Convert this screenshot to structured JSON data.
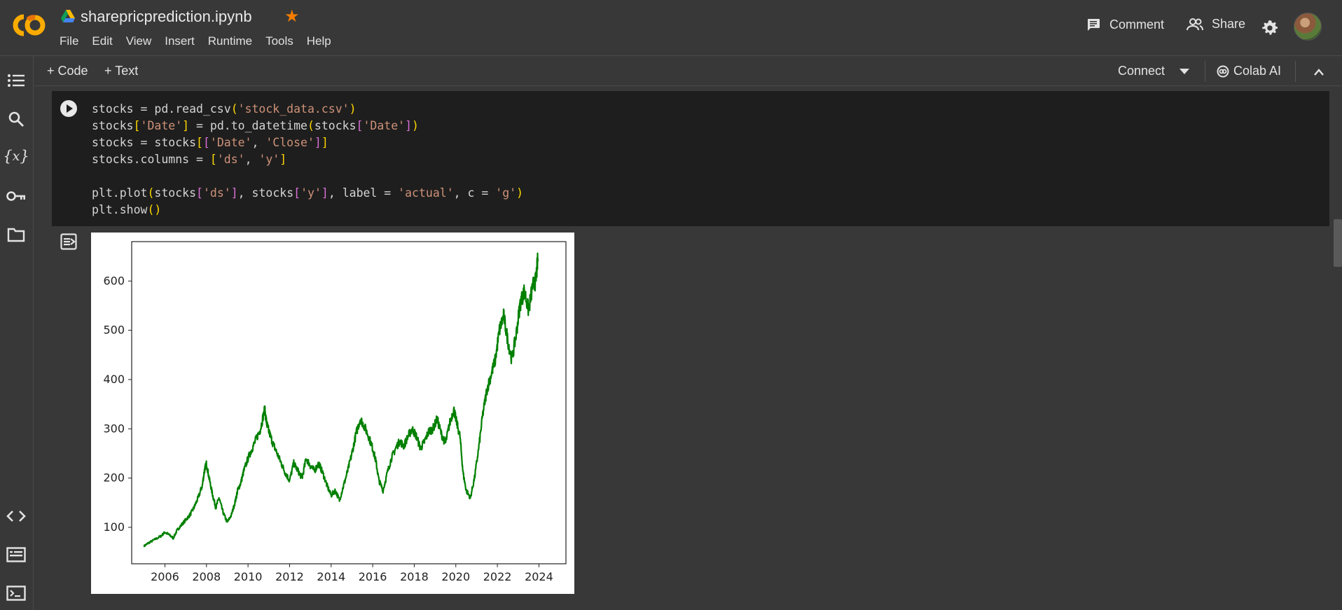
{
  "header": {
    "title": "sharepricprediction.ipynb",
    "menu": [
      "File",
      "Edit",
      "View",
      "Insert",
      "Runtime",
      "Tools",
      "Help"
    ],
    "comment_label": "Comment",
    "share_label": "Share"
  },
  "toolbar": {
    "add_code": "+ Code",
    "add_text": "+ Text",
    "connect": "Connect",
    "colab_ai": "Colab AI"
  },
  "cell": {
    "code_lines": [
      "stocks = pd.read_csv('stock_data.csv')",
      "stocks['Date'] = pd.to_datetime(stocks['Date'])",
      "stocks = stocks[['Date', 'Close']]",
      "stocks.columns = ['ds', 'y']",
      "",
      "plt.plot(stocks['ds'], stocks['y'], label = 'actual', c = 'g')",
      "plt.show()"
    ]
  },
  "colors": {
    "line": "#008000",
    "star": "#f57c00",
    "background": "#383838",
    "cell": "#1e1e1e"
  },
  "chart_data": {
    "type": "line",
    "title": "",
    "xlabel": "",
    "ylabel": "",
    "xlim": [
      2004.4,
      2025.3
    ],
    "ylim": [
      26,
      680
    ],
    "x_ticks": [
      "2006",
      "2008",
      "2010",
      "2012",
      "2014",
      "2016",
      "2018",
      "2020",
      "2022",
      "2024"
    ],
    "y_ticks": [
      "100",
      "200",
      "300",
      "400",
      "500",
      "600"
    ],
    "grid": false,
    "series": [
      {
        "color": "#008000",
        "x": [
          2005.0,
          2005.2,
          2005.5,
          2005.8,
          2006.0,
          2006.2,
          2006.4,
          2006.6,
          2006.8,
          2007.0,
          2007.2,
          2007.4,
          2007.6,
          2007.8,
          2007.9,
          2008.0,
          2008.15,
          2008.3,
          2008.45,
          2008.6,
          2008.8,
          2009.0,
          2009.2,
          2009.4,
          2009.5,
          2009.65,
          2009.8,
          2010.0,
          2010.2,
          2010.4,
          2010.6,
          2010.8,
          2010.9,
          2011.0,
          2011.2,
          2011.4,
          2011.6,
          2011.8,
          2012.0,
          2012.2,
          2012.4,
          2012.6,
          2012.8,
          2013.0,
          2013.2,
          2013.4,
          2013.6,
          2013.8,
          2014.0,
          2014.2,
          2014.4,
          2014.6,
          2014.8,
          2015.0,
          2015.2,
          2015.4,
          2015.6,
          2015.8,
          2016.0,
          2016.15,
          2016.3,
          2016.5,
          2016.7,
          2016.9,
          2017.1,
          2017.3,
          2017.5,
          2017.7,
          2017.9,
          2018.1,
          2018.3,
          2018.5,
          2018.7,
          2018.9,
          2019.1,
          2019.3,
          2019.5,
          2019.7,
          2019.9,
          2020.0,
          2020.2,
          2020.35,
          2020.5,
          2020.7,
          2020.9,
          2021.1,
          2021.3,
          2021.5,
          2021.7,
          2021.9,
          2022.1,
          2022.3,
          2022.5,
          2022.7,
          2022.9,
          2023.1,
          2023.3,
          2023.5,
          2023.7,
          2023.85,
          2023.95
        ],
        "y": [
          62,
          68,
          75,
          82,
          90,
          85,
          78,
          95,
          105,
          115,
          125,
          140,
          160,
          185,
          215,
          230,
          195,
          165,
          140,
          160,
          130,
          110,
          125,
          155,
          175,
          190,
          215,
          240,
          260,
          280,
          300,
          340,
          310,
          295,
          270,
          250,
          230,
          210,
          195,
          230,
          215,
          200,
          240,
          225,
          215,
          230,
          210,
          185,
          165,
          175,
          155,
          185,
          215,
          250,
          290,
          320,
          305,
          285,
          260,
          235,
          195,
          175,
          210,
          240,
          260,
          275,
          265,
          285,
          300,
          285,
          260,
          275,
          295,
          300,
          320,
          290,
          270,
          310,
          340,
          320,
          285,
          210,
          175,
          160,
          200,
          260,
          330,
          380,
          410,
          440,
          500,
          530,
          480,
          440,
          490,
          555,
          580,
          540,
          590,
          600,
          645
        ]
      }
    ]
  }
}
